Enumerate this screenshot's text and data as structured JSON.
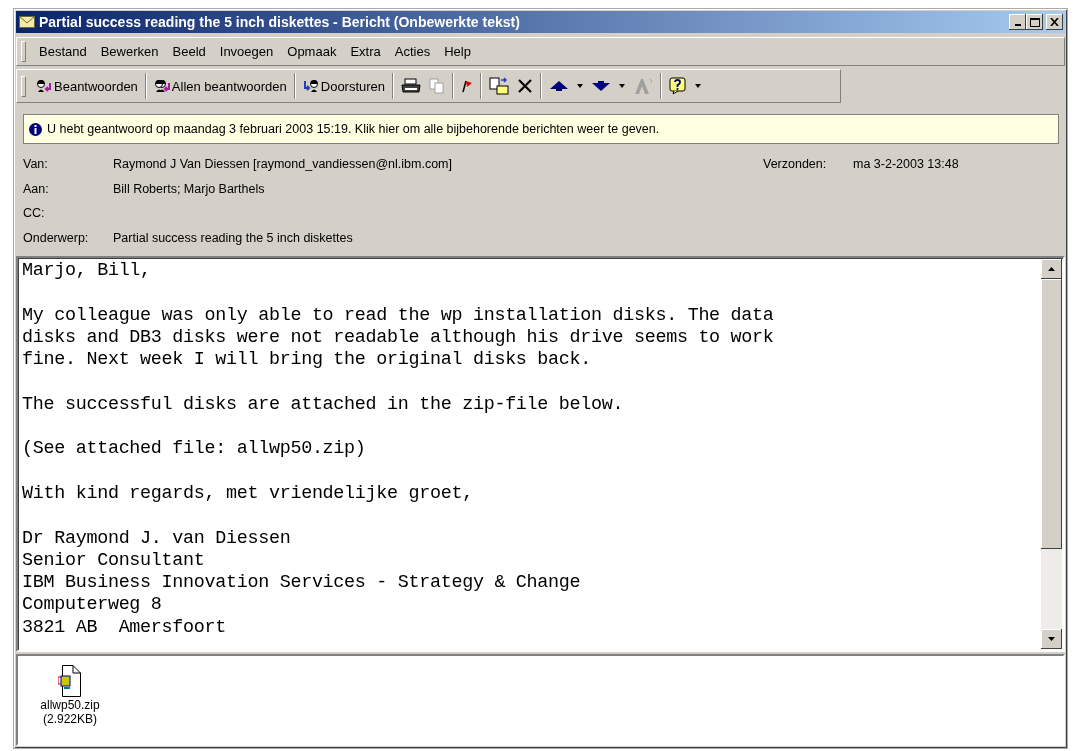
{
  "window": {
    "title": "Partial success reading the 5 inch diskettes - Bericht (Onbewerkte tekst)"
  },
  "menu": [
    {
      "label": "Bestand"
    },
    {
      "label": "Bewerken"
    },
    {
      "label": "Beeld"
    },
    {
      "label": "Invoegen"
    },
    {
      "label": "Opmaak"
    },
    {
      "label": "Extra"
    },
    {
      "label": "Acties"
    },
    {
      "label": "Help"
    }
  ],
  "toolbar": {
    "buttons": [
      {
        "label": "Beantwoorden"
      },
      {
        "label": "Allen beantwoorden"
      },
      {
        "label": "Doorsturen"
      }
    ]
  },
  "info_bar": {
    "text": "U hebt geantwoord op maandag 3 februari 2003 15:19. Klik hier om alle bijbehorende berichten weer te geven."
  },
  "header": {
    "fields": [
      {
        "label": "Van:",
        "value": "Raymond J Van Diessen [raymond_vandiessen@nl.ibm.com]"
      },
      {
        "label": "Aan:",
        "value": "Bill Roberts; Marjo Barthels"
      },
      {
        "label": "CC:"
      },
      {
        "label": "Onderwerp:",
        "value": "Partial success reading the 5 inch diskettes"
      }
    ],
    "sent": {
      "label": "Verzonden:",
      "value": "ma 3-2-2003 13:48"
    }
  },
  "body": {
    "paragraphs": [
      [
        "Marjo, Bill,"
      ],
      [
        "My colleague was only able to read the wp installation disks. The data",
        "disks and DB3 disks were not readable although his drive seems to work",
        "fine. Next week I will bring the original disks back."
      ],
      [
        "The successful disks are attached in the zip-file below."
      ],
      [
        "(See attached file: allwp50.zip)"
      ],
      [
        "With kind regards, met vriendelijke groet,"
      ],
      [
        "Dr Raymond J. van Diessen",
        "Senior Consultant",
        "IBM Business Innovation Services - Strategy & Change",
        "Computerweg 8",
        "3821 AB  Amersfoort"
      ]
    ]
  },
  "attachments": [
    {
      "name": "allwp50.zip",
      "size": "(2.922KB)"
    }
  ]
}
